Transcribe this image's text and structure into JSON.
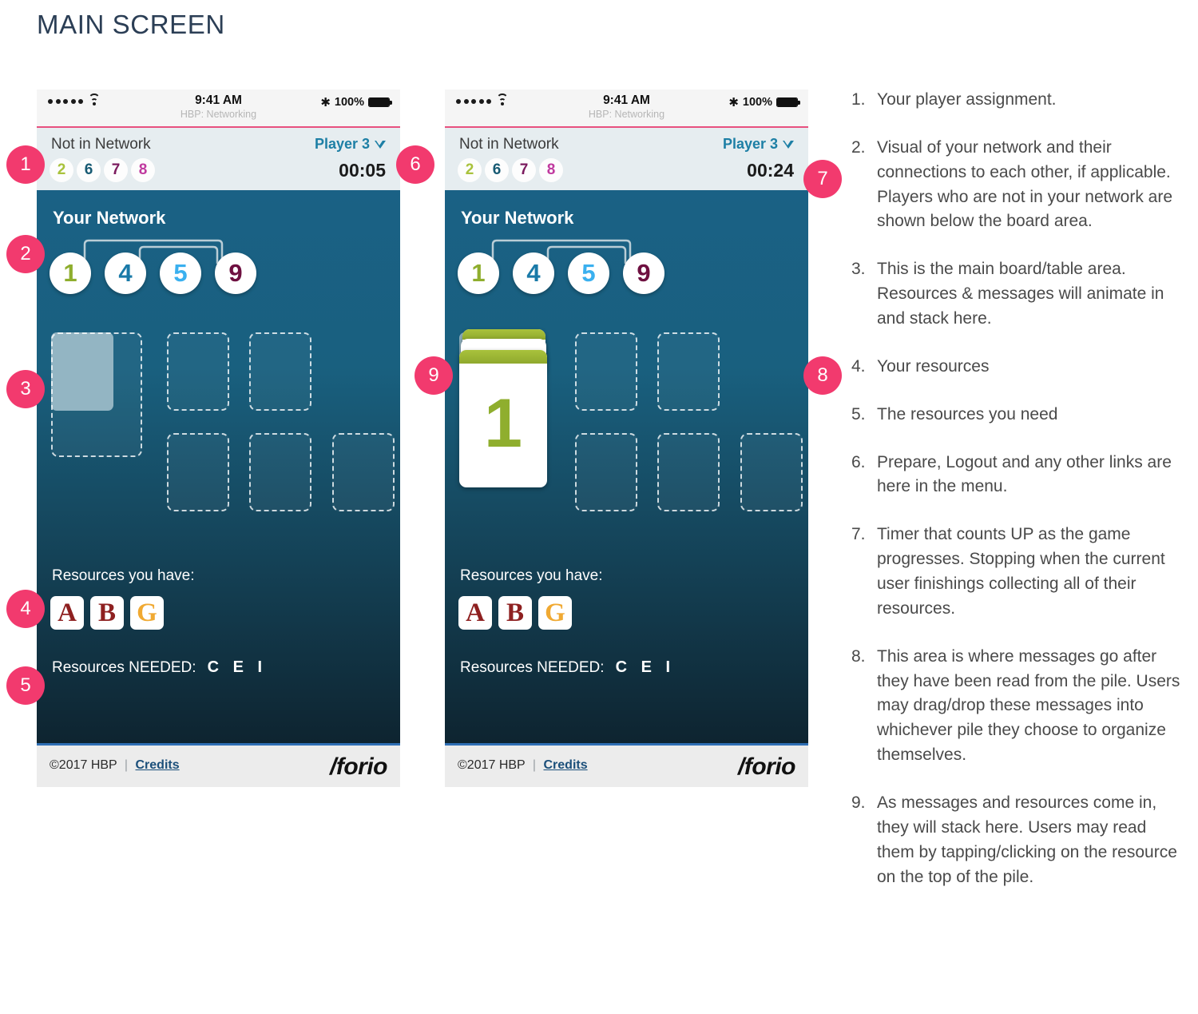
{
  "page_title": "MAIN SCREEN",
  "colors": {
    "badge_pink": "#f23a6e",
    "board_top": "#1a6185",
    "board_bottom": "#0e2430",
    "player_link": "#1d7fa5",
    "header_bg": "#e6edf0",
    "accent_rule": "#e8517f",
    "footer_rule": "#2f6fb5",
    "card_green": "#a9c23c"
  },
  "status_bar": {
    "time": "9:41 AM",
    "subtitle": "HBP: Networking",
    "battery_label": "100%",
    "signal_dots": 5,
    "wifi_icon": "wifi-icon",
    "bluetooth_icon": "✱",
    "battery_icon": "battery-icon"
  },
  "app_header": {
    "not_in_network_label": "Not in Network",
    "not_in_network_players": [
      {
        "num": "2",
        "color": "#a9c23c"
      },
      {
        "num": "6",
        "color": "#175a73"
      },
      {
        "num": "7",
        "color": "#7b1b5e"
      },
      {
        "num": "8",
        "color": "#c0399f"
      }
    ],
    "player_label": "Player 3",
    "caret_icon": "chevron-down-icon"
  },
  "board": {
    "title": "Your Network",
    "network_players": [
      {
        "num": "1",
        "color": "#8fae2e"
      },
      {
        "num": "4",
        "color": "#1a7aa8"
      },
      {
        "num": "5",
        "color": "#3ab0ef"
      },
      {
        "num": "9",
        "color": "#6e1040"
      }
    ],
    "resources_have_label": "Resources you have:",
    "resources_have": [
      {
        "letter": "A",
        "color": "#8e2020"
      },
      {
        "letter": "B",
        "color": "#8e2020"
      },
      {
        "letter": "G",
        "color": "#f0a932"
      }
    ],
    "resources_needed_label": "Resources NEEDED:",
    "resources_needed": "C E I"
  },
  "footer": {
    "copyright": "©2017 HBP",
    "separator": "|",
    "credits_label": "Credits",
    "logo": "/forio"
  },
  "phones": [
    {
      "id": "phone-1",
      "timer": "00:05",
      "has_card_stack": false,
      "card_stack_value": ""
    },
    {
      "id": "phone-2",
      "timer": "00:24",
      "has_card_stack": true,
      "card_stack_value": "1"
    }
  ],
  "badges": {
    "b1": "1",
    "b2": "2",
    "b3": "3",
    "b4": "4",
    "b5": "5",
    "b6": "6",
    "b7": "7",
    "b8": "8",
    "b9": "9"
  },
  "notes": [
    {
      "num": "1.",
      "text": "Your player assignment."
    },
    {
      "num": "2.",
      "text": "Visual of your network and their connections to each other, if applicable. Players who are not in your network are shown below the board area."
    },
    {
      "num": "3.",
      "text": "This is the main board/table area. Resources & messages will animate in and stack here."
    },
    {
      "num": "4.",
      "text": "Your resources"
    },
    {
      "num": "5.",
      "text": "The resources you need"
    },
    {
      "num": "6.",
      "text": "Prepare, Logout and any other links are here in the menu."
    },
    {
      "num": "7.",
      "text": "Timer that counts UP as the game progresses. Stopping when the current user finishings collecting all of their resources."
    },
    {
      "num": "8.",
      "text": "This area is where messages go after they have been read from the pile. Users may drag/drop these messages into whichever pile they choose to organize themselves."
    },
    {
      "num": "9.",
      "text": "As messages and resources come in, they will stack here. Users may read them by tapping/clicking on the resource on the top of the pile."
    }
  ]
}
